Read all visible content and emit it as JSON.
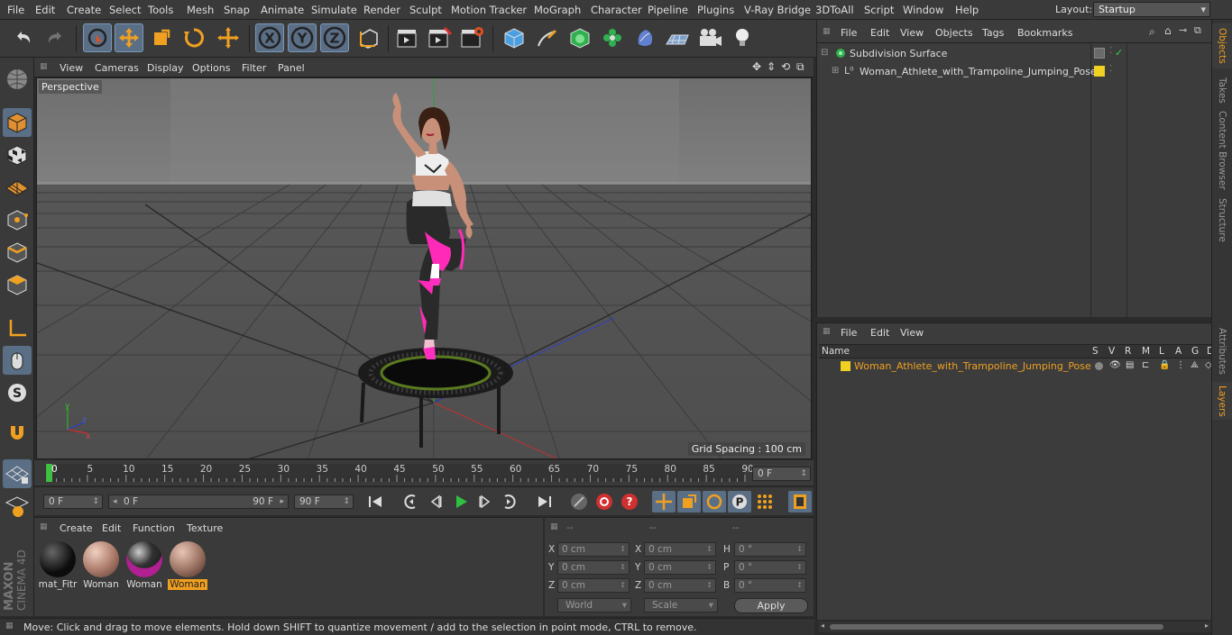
{
  "menubar": {
    "items": [
      "File",
      "Edit",
      "Create",
      "Select",
      "Tools",
      "Mesh",
      "Snap",
      "Animate",
      "Simulate",
      "Render",
      "Sculpt",
      "Motion Tracker",
      "MoGraph",
      "Character",
      "Pipeline",
      "Plugins",
      "V-Ray Bridge",
      "3DToAll",
      "Script",
      "Window",
      "Help"
    ],
    "layout_label": "Layout:",
    "layout_value": "Startup"
  },
  "viewport": {
    "menu": [
      "View",
      "Cameras",
      "Display",
      "Options",
      "Filter",
      "Panel"
    ],
    "camera_label": "Perspective",
    "grid_spacing": "Grid Spacing : 100 cm"
  },
  "timeline": {
    "ticks": [
      "0",
      "5",
      "10",
      "15",
      "20",
      "25",
      "30",
      "35",
      "40",
      "45",
      "50",
      "55",
      "60",
      "65",
      "70",
      "75",
      "80",
      "85",
      "90"
    ],
    "current_frame": "0 F"
  },
  "controls": {
    "start_field": "0 F",
    "range_start": "0 F",
    "range_end": "90 F",
    "end_field": "90 F"
  },
  "materials": {
    "menu": [
      "Create",
      "Edit",
      "Function",
      "Texture"
    ],
    "items": [
      {
        "label": "mat_Fitr",
        "color": "#222222",
        "selected": false
      },
      {
        "label": "Woman",
        "color": "#c8a08a",
        "selected": false
      },
      {
        "label": "Woman",
        "color": "#303030",
        "selected": false
      },
      {
        "label": "Woman",
        "color": "#b89080",
        "selected": true
      }
    ]
  },
  "attributes": {
    "header": [
      "--",
      "--",
      "--"
    ],
    "rows": [
      {
        "a": "X",
        "av": "0 cm",
        "b": "X",
        "bv": "0 cm",
        "c": "H",
        "cv": "0 °"
      },
      {
        "a": "Y",
        "av": "0 cm",
        "b": "Y",
        "bv": "0 cm",
        "c": "P",
        "cv": "0 °"
      },
      {
        "a": "Z",
        "av": "0 cm",
        "b": "Z",
        "bv": "0 cm",
        "c": "B",
        "cv": "0 °"
      }
    ],
    "coord_mode": "World",
    "size_mode": "Scale",
    "apply_label": "Apply"
  },
  "status_text": "Move: Click and drag to move elements. Hold down SHIFT to quantize movement / add to the selection in point mode, CTRL to remove.",
  "branding": {
    "maxon": "MAXON",
    "product": "CINEMA 4D"
  },
  "objects": {
    "menu": [
      "File",
      "Edit",
      "View",
      "Objects",
      "Tags",
      "Bookmarks"
    ],
    "rows": [
      {
        "name": "Subdivision Surface"
      },
      {
        "name": "Woman_Athlete_with_Trampoline_Jumping_Pose"
      }
    ]
  },
  "layers": {
    "menu": [
      "File",
      "Edit",
      "View"
    ],
    "columns": [
      "Name",
      "S",
      "V",
      "R",
      "M",
      "L",
      "A",
      "G",
      "D"
    ],
    "row": "Woman_Athlete_with_Trampoline_Jumping_Pose",
    "row_color": "#f0c020"
  },
  "side_tabs": [
    "Objects",
    "Takes",
    "Content Browser",
    "Structure",
    "Attributes",
    "Layers"
  ],
  "colors": {
    "accent": "#f0a020",
    "selection": "#5a6e86"
  }
}
